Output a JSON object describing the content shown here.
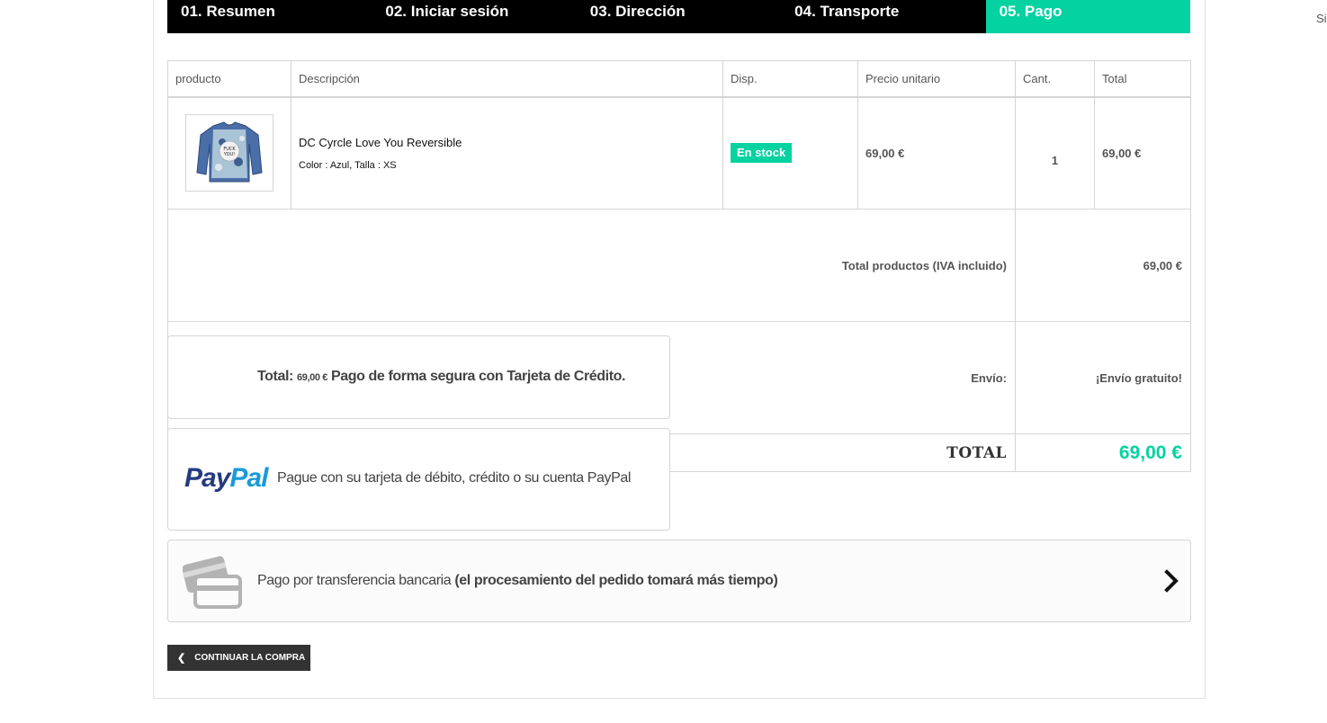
{
  "side_text": "Si",
  "steps": [
    {
      "label": "01. Resumen"
    },
    {
      "label": "02. Iniciar sesión"
    },
    {
      "label": "03. Dirección"
    },
    {
      "label": "04. Transporte"
    },
    {
      "label": "05. Pago"
    }
  ],
  "cart": {
    "headers": [
      "producto",
      "Descripción",
      "Disp.",
      "Precio unitario",
      "Cant.",
      "Total"
    ],
    "item": {
      "name": "DC Cyrcle Love You Reversible",
      "attributes": "Color : Azul, Talla : XS",
      "availability": "En stock",
      "unit_price": "69,00 €",
      "quantity": "1",
      "total": "69,00 €",
      "image_print": "FUCK YOU!"
    },
    "summary": {
      "products_label": "Total productos (IVA incluido)",
      "products_value": "69,00 €",
      "shipping_label": "Envío:",
      "shipping_value": "¡Envío gratuito!",
      "total_label": "TOTAL",
      "total_value": "69,00 €"
    }
  },
  "payment": {
    "card": {
      "prefix": "Total:",
      "amount": "69,00 €",
      "text": "Pago de forma segura con Tarjeta de Crédito."
    },
    "paypal": {
      "logo_part1": "Pay",
      "logo_part2": "Pal",
      "text": "Pague con su tarjeta de débito, crédito o su cuenta PayPal"
    },
    "bank": {
      "text": "Pago por transferencia bancaria",
      "note": "(el procesamiento del pedido tomará más tiempo)"
    }
  },
  "continue_button": "CONTINUAR LA COMPRA",
  "colors": {
    "accent": "#05d2a1",
    "steps_bg": "#000000",
    "button_bg": "#333333"
  }
}
